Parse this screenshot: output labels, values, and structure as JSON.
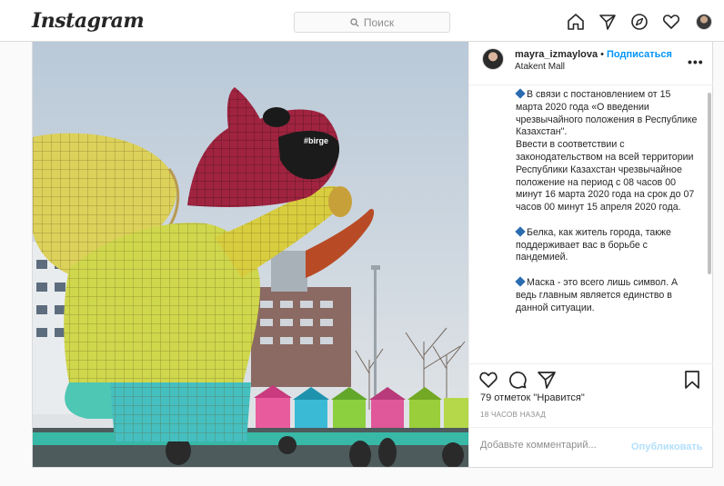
{
  "header": {
    "logo": "Instagram",
    "search_placeholder": "Поиск",
    "nav": [
      "home-icon",
      "direct-icon",
      "explore-icon",
      "activity-icon",
      "profile-avatar"
    ]
  },
  "post": {
    "author": "mayra_izmaylova",
    "separator": "•",
    "follow_label": "Подписаться",
    "location": "Atakent Mall",
    "more_label": "•••",
    "photo_text": "#birge",
    "caption": {
      "p1": "В связи с постановлением от 15 марта 2020 года «О введении чрезвычайного положения в Республике Казахстан\".",
      "p1b": "Ввести в соответствии с законодательством на всей территории Республики Казахстан чрезвычайное положение на период с 08 часов 00 минут 16 марта 2020 года на срок до 07 часов 00 минут 15 апреля 2020 года.",
      "p2": "Белка, как житель города, также поддерживает вас в борьбе с пандемией.",
      "p3": "Маска - это всего лишь символ. А ведь главным является единство в данной ситуации."
    },
    "likes": "79 отметок \"Нравится\"",
    "timestamp": "18 ЧАСОВ НАЗАД",
    "comment_placeholder": "Добавьте комментарий...",
    "publish_label": "Опубликовать"
  },
  "colors": {
    "link": "#0095f6",
    "publish_disabled": "#b2dffc",
    "border": "#dbdbdb",
    "bullet": "#2b6cb0"
  }
}
